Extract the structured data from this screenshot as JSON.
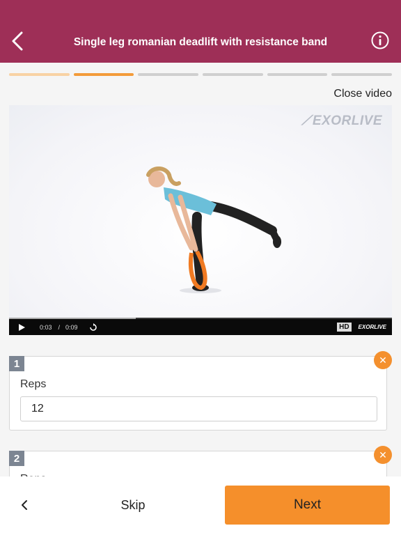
{
  "header": {
    "title": "Single leg romanian deadlift with resistance band",
    "background": "#9e2f57"
  },
  "progress": {
    "segments": [
      {
        "state": "done",
        "color": "#f8d2a4"
      },
      {
        "state": "current",
        "color": "#f39b3a"
      },
      {
        "state": "todo",
        "color": "#cfcfcf"
      },
      {
        "state": "todo",
        "color": "#cfcfcf"
      },
      {
        "state": "todo",
        "color": "#cfcfcf"
      },
      {
        "state": "todo",
        "color": "#cfcfcf"
      }
    ]
  },
  "video": {
    "close_label": "Close video",
    "watermark": "EXORLIVE",
    "current_time": "0:03",
    "separator": "/",
    "duration": "0:09",
    "hd_label": "HD",
    "brand_label": "EXORLIVE",
    "progress_fraction": 0.33
  },
  "sets": [
    {
      "number": "1",
      "reps_label": "Reps",
      "reps_value": "12"
    },
    {
      "number": "2",
      "reps_label": "Reps",
      "reps_value": ""
    }
  ],
  "footer": {
    "skip_label": "Skip",
    "next_label": "Next"
  },
  "colors": {
    "accent": "#f58f2b",
    "badge": "#7c8592"
  }
}
